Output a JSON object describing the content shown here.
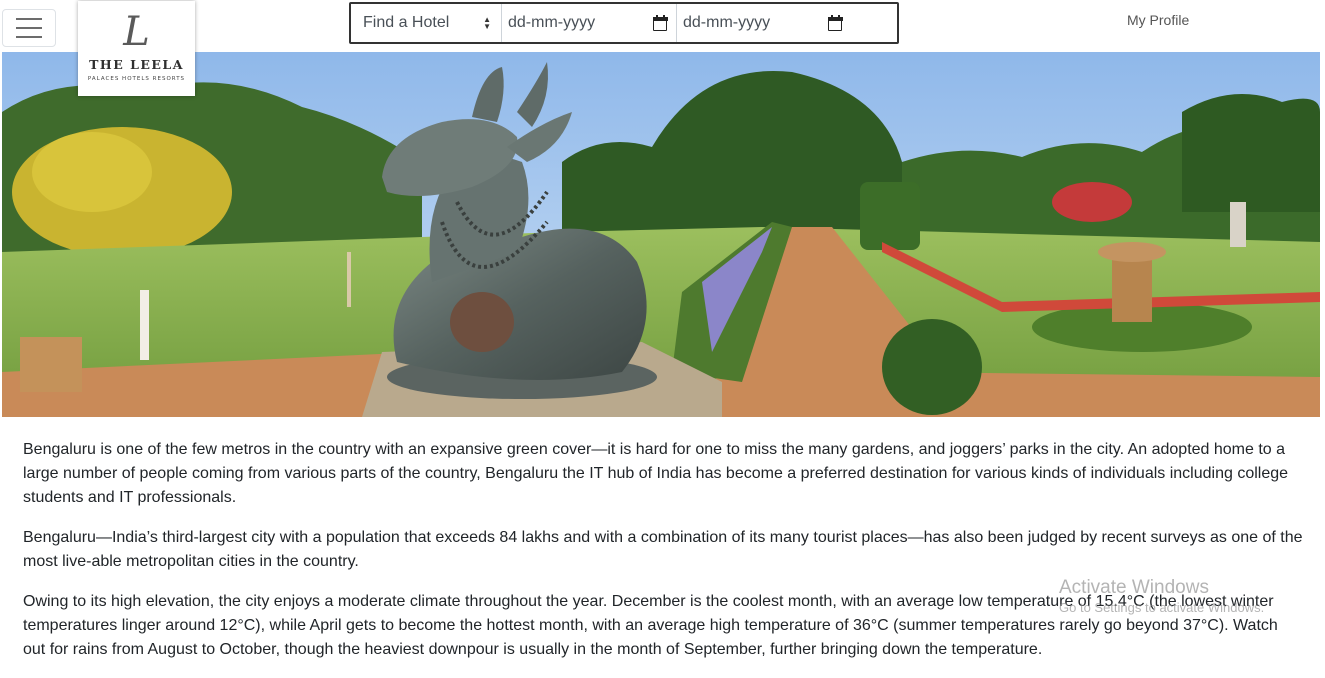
{
  "header": {
    "menu_icon": "hamburger-icon",
    "logo": {
      "mark": "L",
      "name": "THE LEELA",
      "tagline": "PALACES HOTELS RESORTS"
    },
    "search": {
      "hotel_placeholder": "Find a Hotel",
      "checkin_placeholder": "dd-mm-yyyy",
      "checkout_placeholder": "dd-mm-yyyy",
      "calendar_icon": "calendar-icon"
    },
    "profile_label": "My Profile"
  },
  "article": {
    "paragraphs": [
      "Bengaluru is one of the few metros in the country with an expansive green cover—it is hard for one to miss the many gardens, and joggers’ parks in the city. An adopted home to a large number of people coming from various parts of the country, Bengaluru the IT hub of India has become a preferred destination for various kinds of individuals including college students and IT professionals.",
      "Bengaluru—India’s third-largest city with a population that exceeds 84 lakhs and with a combination of its many tourist places—has also been judged by recent surveys as one of the most live-able metropolitan cities in the country.",
      "Owing to its high elevation, the city enjoys a moderate climate throughout the year. December is the coolest month, with an average low temperature of 15.4°C (the lowest winter temperatures linger around 12°C), while April gets to become the hottest month, with an average high temperature of 36°C (summer temperatures rarely go beyond 37°C). Watch out for rains from August to October, though the heaviest downpour is usually in the month of September, further bringing down the temperature."
    ]
  },
  "watermark": {
    "title": "Activate Windows",
    "subtitle": "Go to Settings to activate Windows."
  },
  "colors": {
    "border": "#333333",
    "text": "#212529",
    "link": "#555555",
    "sky": "#a9c9ef",
    "grass": "#7fa54a"
  }
}
